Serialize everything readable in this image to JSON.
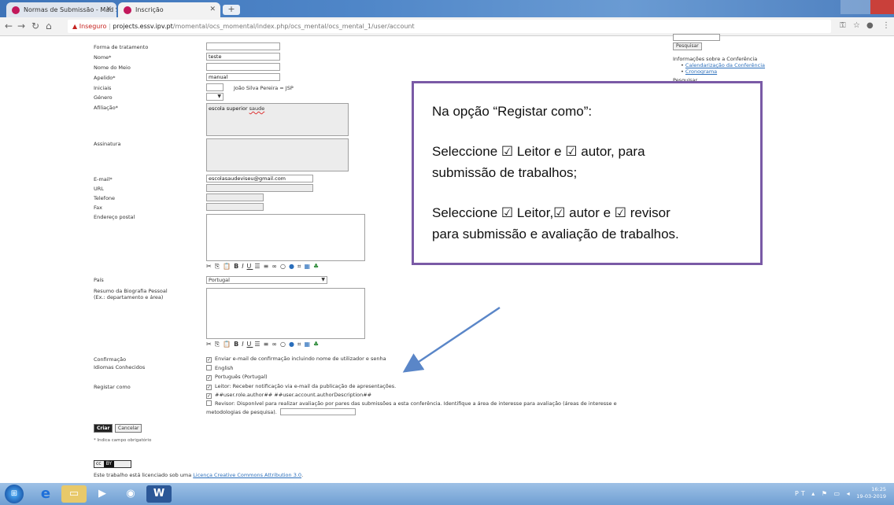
{
  "browser": {
    "tabs": [
      {
        "label": "Normas de Submissão - Mad Sa"
      },
      {
        "label": "Inscrição"
      }
    ],
    "new_tab": "+",
    "insecure_label": "Inseguro",
    "url_host": "projects.essv.ipv.pt",
    "url_path": "/momental/ocs_momental/index.php/ocs_mental/ocs_mental_1/user/account",
    "icons": [
      "back-icon",
      "forward-icon",
      "reload-icon",
      "home-icon",
      "key-icon",
      "star-icon",
      "account-icon",
      "menu-icon"
    ]
  },
  "form": {
    "fields": {
      "forma": {
        "label": "Forma de tratamento",
        "value": ""
      },
      "nome": {
        "label": "Nome*",
        "value": "teste"
      },
      "meio": {
        "label": "Nome do Meio",
        "value": ""
      },
      "apelido": {
        "label": "Apelido*",
        "value": "manual"
      },
      "iniciais": {
        "label": "Iniciais",
        "value": "",
        "hint": "João Silva Pereira = JSP"
      },
      "genero": {
        "label": "Género",
        "value": ""
      },
      "afiliacao": {
        "label": "Afiliação*",
        "value_a": "escola superior ",
        "value_b": "saude"
      },
      "assinatura": {
        "label": "Assinatura",
        "value": ""
      },
      "email": {
        "label": "E-mail*",
        "value": "escolasaudeviseu@gmail.com"
      },
      "url": {
        "label": "URL",
        "value": ""
      },
      "telefone": {
        "label": "Telefone",
        "value": ""
      },
      "fax": {
        "label": "Fax",
        "value": ""
      },
      "endereco": {
        "label": "Endereço postal",
        "value": ""
      },
      "pais": {
        "label": "País",
        "value": "Portugal"
      },
      "resumo": {
        "label": "Resumo da Biografia Pessoal",
        "label2": "(Ex.: departamento e área)",
        "value": ""
      }
    },
    "confirmacao": {
      "label": "Confirmação",
      "option": "Enviar e-mail de confirmação incluindo nome de utilizador e senha"
    },
    "idiomas": {
      "label": "Idiomas Conhecidos",
      "options": [
        "English",
        "Português (Portugal)"
      ]
    },
    "registar": {
      "label": "Registar como",
      "options": [
        "Leitor: Receber notificação via e-mail da publicação de apresentações.",
        "##user.role.author## ##user.account.authorDescription##",
        "Revisor: Disponível para realizar avaliação por pares das submissões a esta conferência. Identifique a área de interesse para avaliação (áreas de interesse e",
        "metodologias de pesquisa)."
      ]
    },
    "buttons": {
      "criar": "Criar",
      "cancelar": "Cancelar"
    },
    "required_note": "* Indica campo obrigatório",
    "cc_badge": "cc",
    "cc_by": "BY",
    "license_text": "Este trabalho está licenciado sob uma ",
    "license_link": "Licença Creative Commons Attribution 3.0",
    "license_end": "."
  },
  "sidebar": {
    "search_button": "Pesquisar",
    "info_title": "Informações sobre a Conferência",
    "links": [
      "Calendarização da Conferência",
      "Cronograma"
    ],
    "search_title": "Pesquisar"
  },
  "callout": {
    "line1": "Na opção “Registar como”:",
    "line2": "Seleccione ☑ Leitor e ☑ autor, para",
    "line3": "submissão de trabalhos;",
    "line4": "Seleccione ☑ Leitor,☑ autor e ☑ revisor",
    "line5": "para submissão e avaliação de trabalhos.",
    "border_color": "#7a5aa6",
    "arrow_color": "#5a86c8"
  },
  "taskbar": {
    "time": "16:25",
    "date": "19-03-2019",
    "lang": "PT",
    "icons": [
      "windows-start-icon",
      "ie-icon",
      "explorer-icon",
      "media-icon",
      "chrome-icon",
      "word-icon"
    ]
  }
}
